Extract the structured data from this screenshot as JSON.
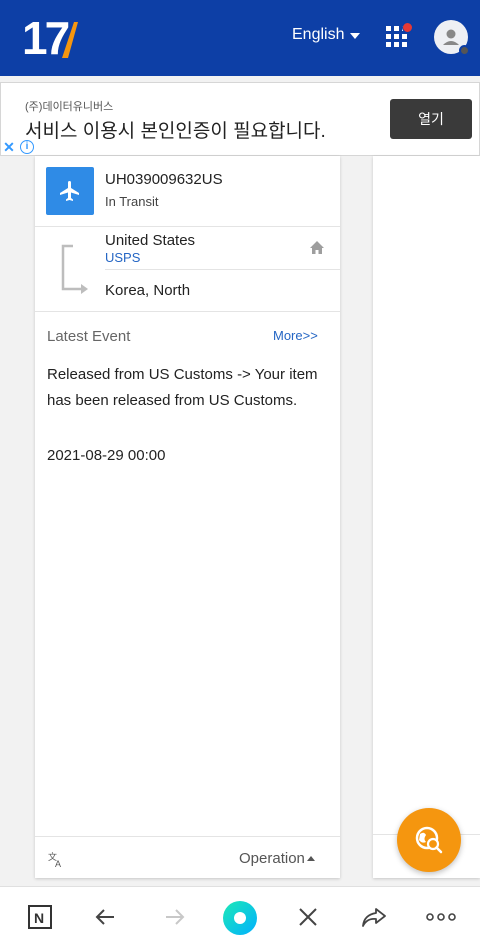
{
  "header": {
    "logo_text": "17",
    "language": "English"
  },
  "ad": {
    "advertiser": "(주)데이터유니버스",
    "headline": "서비스 이용시 본인인증이 필요합니다.",
    "button": "열기"
  },
  "shipment": {
    "tracking_number": "UH039009632US",
    "status": "In Transit",
    "origin": "United States",
    "carrier": "USPS",
    "destination": "Korea, North",
    "latest_event_label": "Latest Event",
    "more_link": "More>>",
    "event_text": "Released from US Customs -> Your item has been released from US Customs.",
    "event_time": "2021-08-29 00:00",
    "operation_label": "Operation"
  },
  "colors": {
    "header_bg": "#0d3fa6",
    "fab": "#f5960f",
    "plane_box": "#2f8be6",
    "link": "#2566c4"
  },
  "icons": [
    "airplane-icon",
    "route-icon",
    "home-icon",
    "translate-icon",
    "search-globe-icon",
    "apps-grid-icon",
    "user-avatar-icon",
    "n-logo-icon",
    "back-arrow-icon",
    "forward-arrow-icon",
    "home-dot-icon",
    "close-icon",
    "share-icon",
    "more-dots-icon"
  ]
}
